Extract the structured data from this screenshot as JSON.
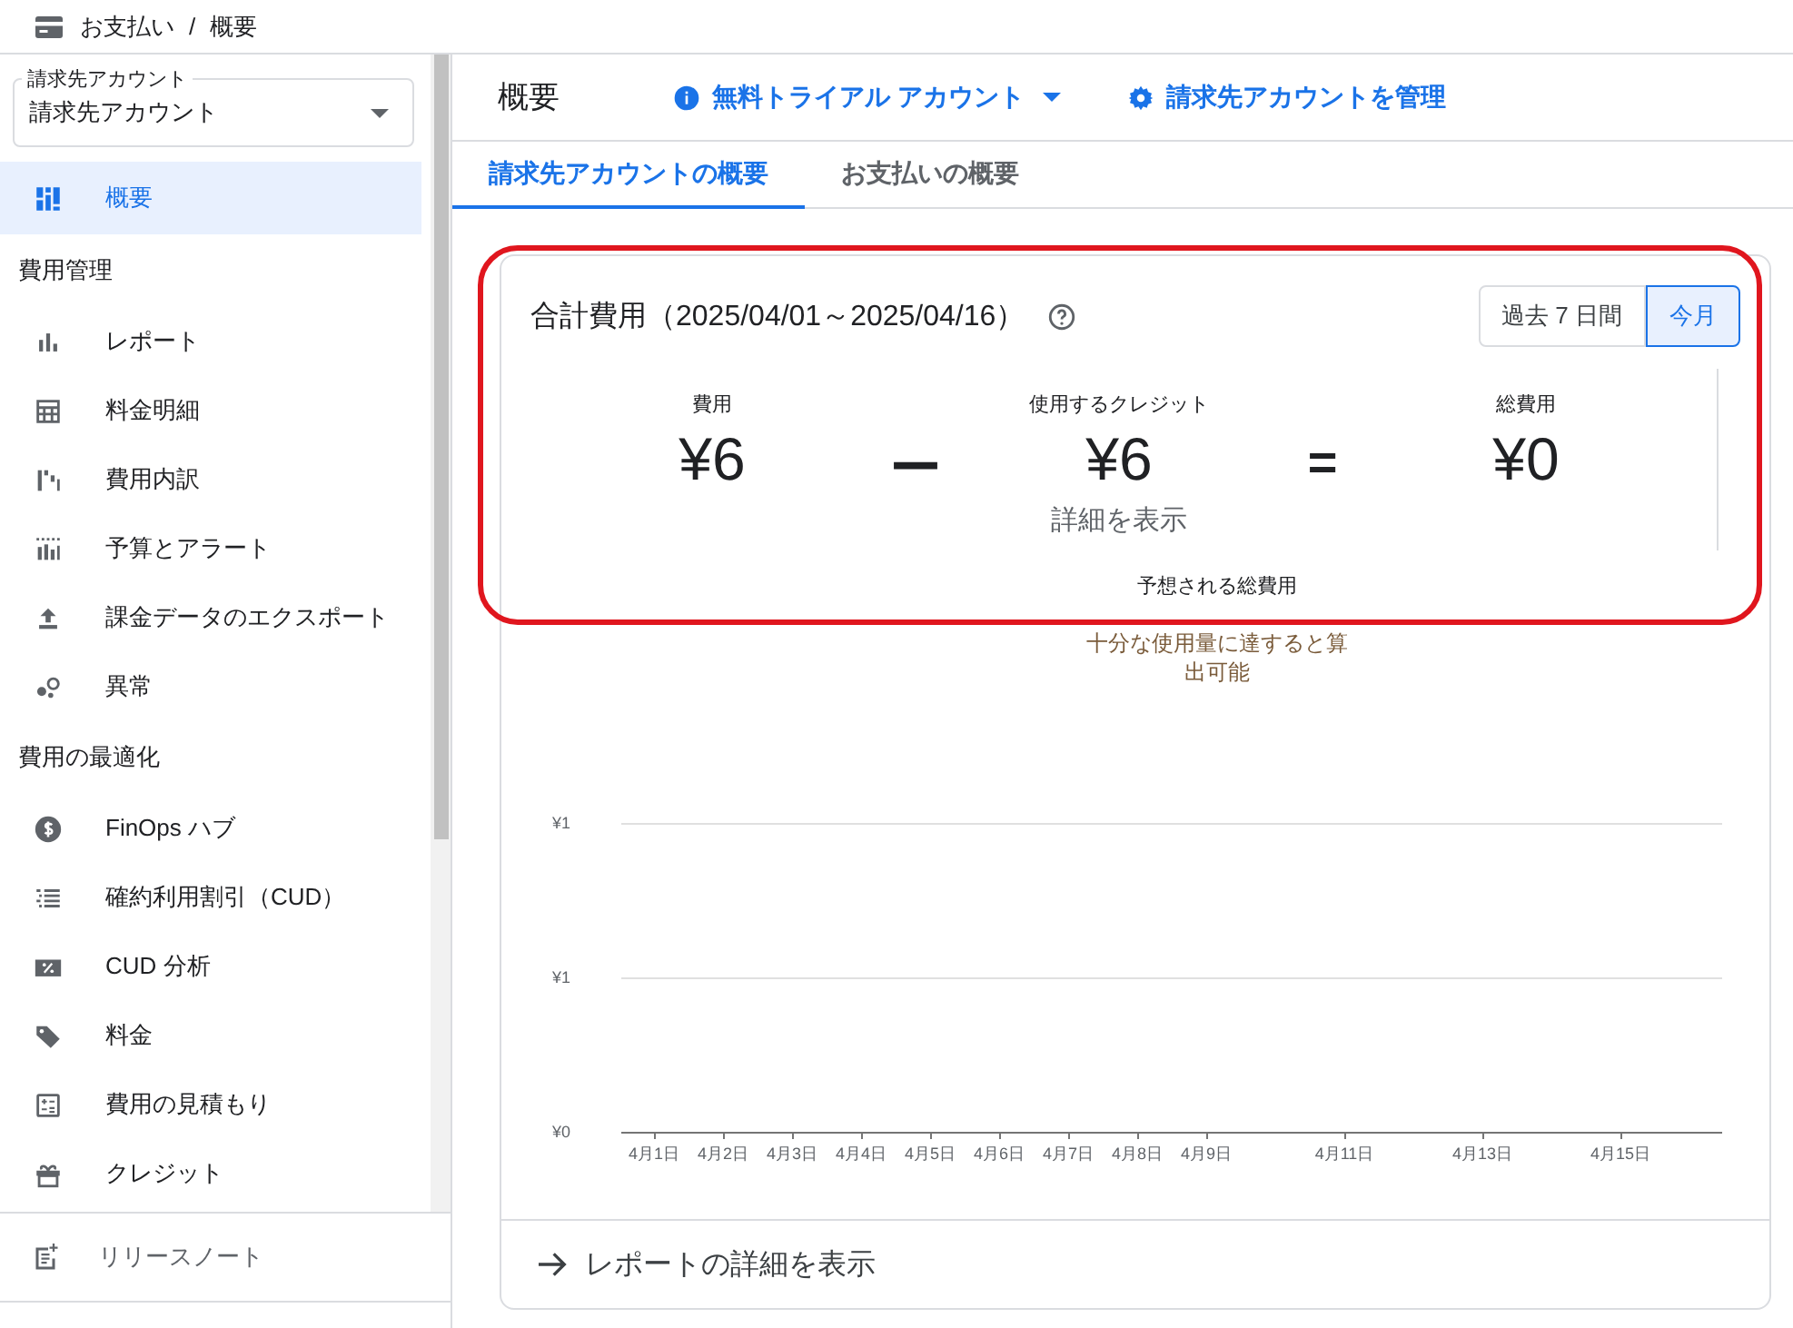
{
  "breadcrumb": {
    "items": [
      "お支払い",
      "概要"
    ],
    "separator": "/"
  },
  "sidebar": {
    "account_select": {
      "label": "請求先アカウント",
      "value": "請求先アカウント"
    },
    "items": [
      {
        "kind": "item",
        "label": "概要",
        "selected": true
      },
      {
        "kind": "heading",
        "label": "費用管理"
      },
      {
        "kind": "item",
        "label": "レポート",
        "selected": false
      },
      {
        "kind": "item",
        "label": "料金明細",
        "selected": false
      },
      {
        "kind": "item",
        "label": "費用内訳",
        "selected": false
      },
      {
        "kind": "item",
        "label": "予算とアラート",
        "selected": false
      },
      {
        "kind": "item",
        "label": "課金データのエクスポート",
        "selected": false
      },
      {
        "kind": "item",
        "label": "異常",
        "selected": false
      },
      {
        "kind": "heading",
        "label": "費用の最適化"
      },
      {
        "kind": "item",
        "label": "FinOps ハブ",
        "selected": false
      },
      {
        "kind": "item",
        "label": "確約利用割引（CUD）",
        "selected": false
      },
      {
        "kind": "item",
        "label": "CUD 分析",
        "selected": false
      },
      {
        "kind": "item",
        "label": "料金",
        "selected": false
      },
      {
        "kind": "item",
        "label": "費用の見積もり",
        "selected": false
      },
      {
        "kind": "item",
        "label": "クレジット",
        "selected": false
      }
    ],
    "footer": {
      "label": "リリースノート"
    }
  },
  "header": {
    "title": "概要",
    "links": [
      {
        "kind": "dropdown",
        "label": "無料トライアル アカウント"
      },
      {
        "kind": "settings",
        "label": "請求先アカウントを管理"
      }
    ]
  },
  "tabs": [
    {
      "label": "請求先アカウントの概要",
      "selected": true
    },
    {
      "label": "お支払いの概要",
      "selected": false
    }
  ],
  "cost_card": {
    "title": "合計費用（2025/04/01～2025/04/16）",
    "highlighted": true,
    "range_buttons": [
      {
        "label": "過去 7 日間",
        "selected": false
      },
      {
        "label": "今月",
        "selected": true
      }
    ],
    "figures": [
      {
        "label": "費用",
        "value": "¥6"
      },
      {
        "label": "使用するクレジット",
        "value": "¥6"
      },
      {
        "label": "総費用",
        "value": "¥0"
      }
    ],
    "operators": [
      "ー",
      "="
    ],
    "details_link": "詳細を表示",
    "forecast": {
      "label": "予想される総費用",
      "note": "十分な使用量に達すると算出可能"
    },
    "chart": {
      "y_labels": [
        "¥1",
        "¥1",
        "¥0"
      ],
      "x_labels": [
        "4月1日",
        "4月2日",
        "4月3日",
        "4月4日",
        "4月5日",
        "4月6日",
        "4月7日",
        "4月8日",
        "4月9日",
        "4月11日",
        "4月13日",
        "4月15日"
      ]
    },
    "report_link": "レポートの詳細を表示"
  }
}
